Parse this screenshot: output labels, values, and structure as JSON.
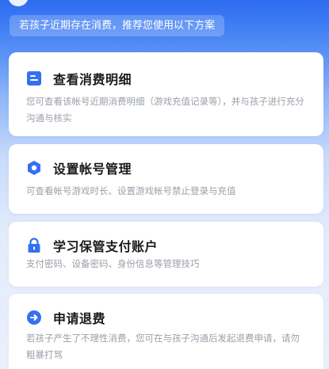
{
  "banner": {
    "text": "若孩子近期存在消费，推荐您使用以下方案"
  },
  "cards": [
    {
      "title": "查看消费明细",
      "description": "您可查看该帐号近期消费明细（游戏充值记录等），并与孩子进行充分沟通与核实",
      "icon": "document-icon"
    },
    {
      "title": "设置帐号管理",
      "description": "可查看帐号游戏时长、设置游戏帐号禁止登录与充值",
      "icon": "hexagon-settings-icon"
    },
    {
      "title": "学习保管支付账户",
      "description": "支付密码、设备密码、身份信息等管理技巧",
      "icon": "lock-icon"
    },
    {
      "title": "申请退费",
      "description": "若孩子产生了不理性消费，您可在与孩子沟通后发起退费申请，请勿粗暴打骂",
      "icon": "arrow-circle-icon"
    }
  ],
  "colors": {
    "accent": "#3670f0",
    "title": "#1a1a1a",
    "description": "#9aa0a8"
  }
}
